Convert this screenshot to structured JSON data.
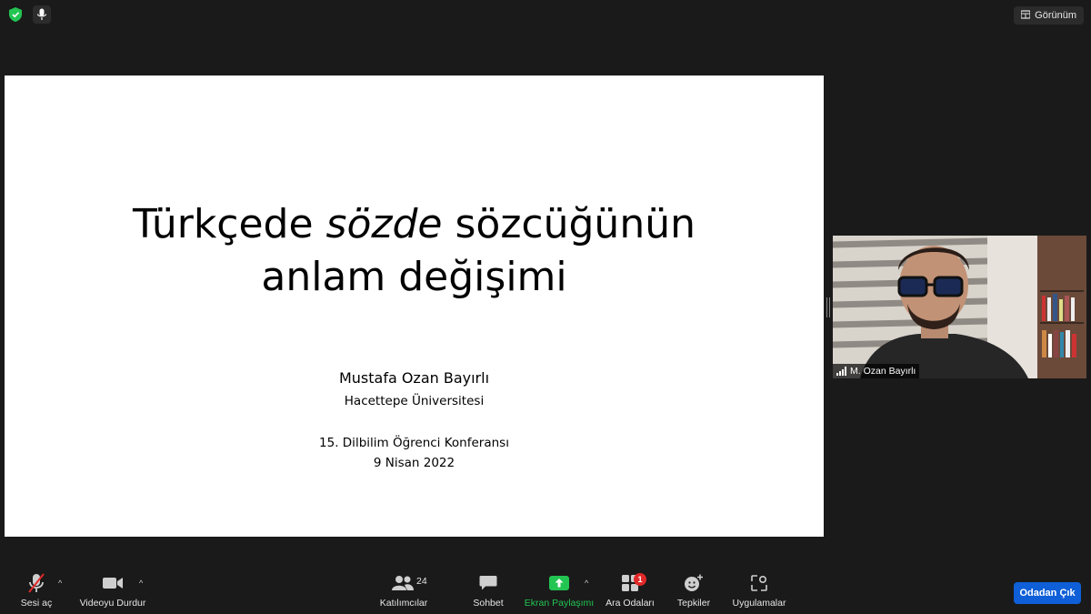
{
  "top_bar": {
    "view_label": "Görünüm"
  },
  "slide": {
    "title_line1_a": "Türkçede ",
    "title_line1_italic": "sözde",
    "title_line1_b": " sözcüğünün",
    "title_line2": "anlam değişimi",
    "author": "Mustafa Ozan Bayırlı",
    "university": "Hacettepe Üniversitesi",
    "conference": "15. Dilbilim Öğrenci Konferansı",
    "date": "9 Nisan 2022"
  },
  "participant": {
    "name": "M. Ozan Bayırlı"
  },
  "toolbar": {
    "unmute": "Sesi aç",
    "stop_video": "Videoyu Durdur",
    "participants": "Katılımcılar",
    "participants_count": "24",
    "chat": "Sohbet",
    "share_screen": "Ekran Paylaşımı",
    "breakout_rooms": "Ara Odaları",
    "breakout_badge": "1",
    "reactions": "Tepkiler",
    "apps": "Uygulamalar",
    "leave": "Odadan Çık"
  },
  "colors": {
    "leave": "#0e5fd8",
    "share": "#23c552",
    "badge": "#e02828",
    "shield": "#23c552"
  },
  "icons": [
    "shield-icon",
    "mic-off-icon",
    "grid-view-icon",
    "video-camera-icon",
    "participants-icon",
    "chat-icon",
    "share-screen-icon",
    "breakout-rooms-icon",
    "reactions-icon",
    "apps-icon",
    "signal-icon"
  ]
}
